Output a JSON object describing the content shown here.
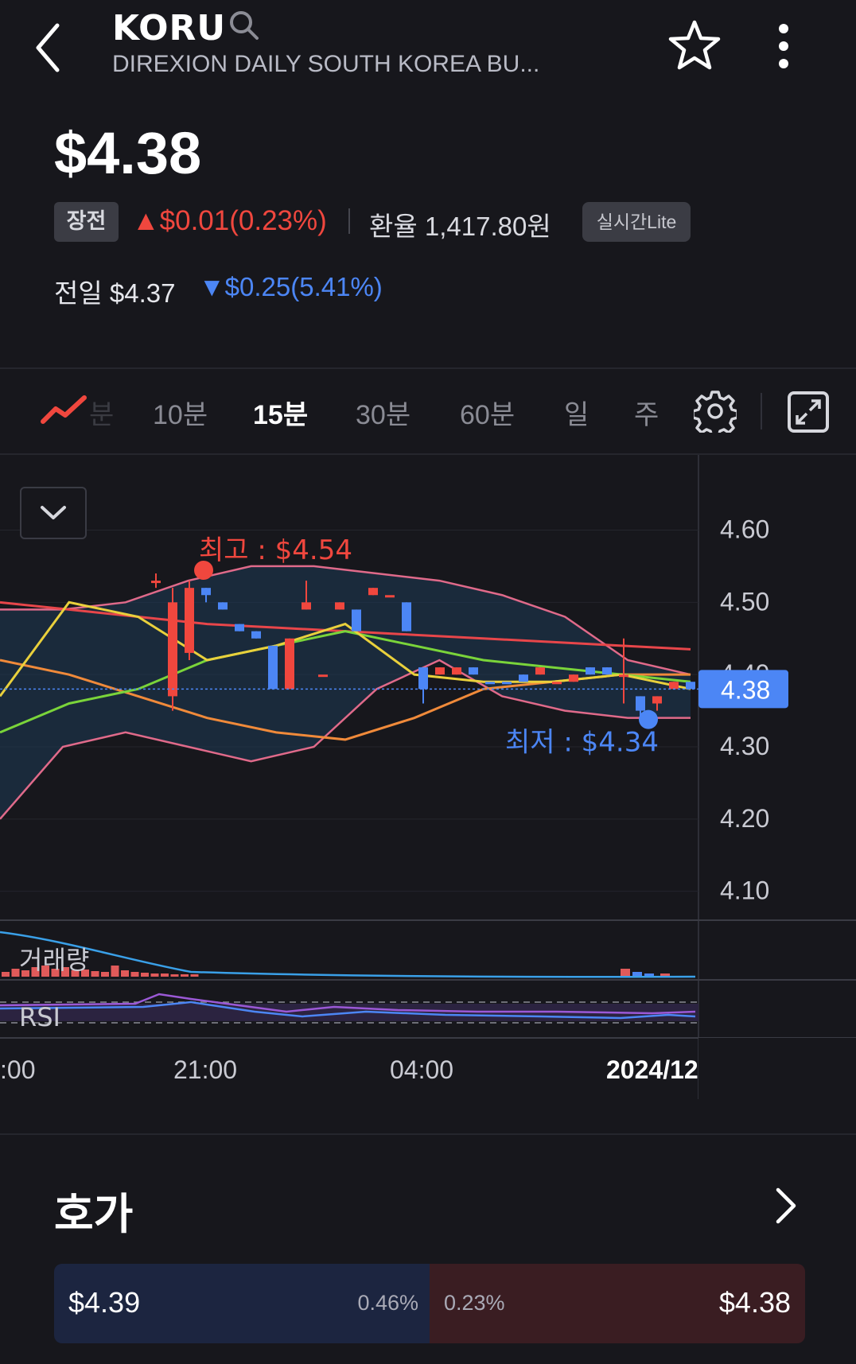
{
  "header": {
    "ticker": "KORU",
    "fullname": "DIREXION DAILY SOUTH KOREA BU...",
    "icons": [
      "back-arrow-icon",
      "search-icon",
      "star-icon",
      "more-vertical-icon"
    ]
  },
  "quote": {
    "price": "$4.38",
    "session": "장전",
    "change": "▲$0.01(0.23%)",
    "fx": "환율 1,417.80원",
    "realtime": "실시간Lite",
    "prev_label": "전일 $4.37",
    "prev_change": "▼$0.25(5.41%)",
    "colors": {
      "up": "#f0473e",
      "down": "#4c86f5"
    }
  },
  "tabs": {
    "faded_partial": "분",
    "items": [
      {
        "label": "10분",
        "active": false
      },
      {
        "label": "15분",
        "active": true
      },
      {
        "label": "30분",
        "active": false
      },
      {
        "label": "60분",
        "active": false
      },
      {
        "label": "일",
        "active": false
      },
      {
        "label": "주",
        "active": false
      }
    ],
    "icons": [
      "line-chart-icon",
      "gear-icon",
      "expand-icon",
      "chevron-down-icon"
    ]
  },
  "chart_data": {
    "type": "candlestick",
    "interval": "15분",
    "y_ticks": [
      "4.60",
      "4.50",
      "4.40",
      "4.30",
      "4.20",
      "4.10"
    ],
    "y_range": [
      4.06,
      4.66
    ],
    "current_price_label": "4.38",
    "current_price": 4.38,
    "high_label": "최고 : $4.54",
    "high": 4.54,
    "low_label": "최저 : $4.34",
    "low": 4.34,
    "x_labels": [
      ":00",
      "21:00",
      "04:00",
      "2024/12"
    ],
    "volume_label": "거래량",
    "rsi_label": "RSI",
    "candles": [
      {
        "o": 4.53,
        "c": 4.53,
        "h": 4.54,
        "l": 4.52,
        "dir": "up"
      },
      {
        "o": 4.37,
        "c": 4.5,
        "h": 4.52,
        "l": 4.35,
        "dir": "up"
      },
      {
        "o": 4.43,
        "c": 4.52,
        "h": 4.53,
        "l": 4.42,
        "dir": "up"
      },
      {
        "o": 4.52,
        "c": 4.51,
        "h": 4.52,
        "l": 4.5,
        "dir": "down"
      },
      {
        "o": 4.5,
        "c": 4.49,
        "h": 4.5,
        "l": 4.49,
        "dir": "down"
      },
      {
        "o": 4.47,
        "c": 4.46,
        "h": 4.47,
        "l": 4.46,
        "dir": "down"
      },
      {
        "o": 4.46,
        "c": 4.45,
        "h": 4.46,
        "l": 4.45,
        "dir": "down"
      },
      {
        "o": 4.44,
        "c": 4.38,
        "h": 4.44,
        "l": 4.38,
        "dir": "down"
      },
      {
        "o": 4.38,
        "c": 4.45,
        "h": 4.45,
        "l": 4.38,
        "dir": "up"
      },
      {
        "o": 4.49,
        "c": 4.5,
        "h": 4.53,
        "l": 4.49,
        "dir": "up"
      },
      {
        "o": 4.4,
        "c": 4.4,
        "h": 4.4,
        "l": 4.4,
        "dir": "up"
      },
      {
        "o": 4.49,
        "c": 4.5,
        "h": 4.5,
        "l": 4.49,
        "dir": "up"
      },
      {
        "o": 4.46,
        "c": 4.49,
        "h": 4.49,
        "l": 4.46,
        "dir": "down"
      },
      {
        "o": 4.52,
        "c": 4.51,
        "h": 4.52,
        "l": 4.51,
        "dir": "up"
      },
      {
        "o": 4.51,
        "c": 4.51,
        "h": 4.51,
        "l": 4.51,
        "dir": "up"
      },
      {
        "o": 4.5,
        "c": 4.46,
        "h": 4.5,
        "l": 4.46,
        "dir": "down"
      },
      {
        "o": 4.41,
        "c": 4.38,
        "h": 4.41,
        "l": 4.36,
        "dir": "down"
      },
      {
        "o": 4.4,
        "c": 4.41,
        "h": 4.41,
        "l": 4.4,
        "dir": "up"
      },
      {
        "o": 4.4,
        "c": 4.41,
        "h": 4.41,
        "l": 4.4,
        "dir": "up"
      },
      {
        "o": 4.41,
        "c": 4.4,
        "h": 4.41,
        "l": 4.4,
        "dir": "down"
      },
      {
        "o": 4.39,
        "c": 4.39,
        "h": 4.39,
        "l": 4.39,
        "dir": "down"
      },
      {
        "o": 4.39,
        "c": 4.39,
        "h": 4.39,
        "l": 4.39,
        "dir": "down"
      },
      {
        "o": 4.4,
        "c": 4.39,
        "h": 4.4,
        "l": 4.39,
        "dir": "down"
      },
      {
        "o": 4.4,
        "c": 4.41,
        "h": 4.41,
        "l": 4.4,
        "dir": "up"
      },
      {
        "o": 4.39,
        "c": 4.39,
        "h": 4.39,
        "l": 4.39,
        "dir": "up"
      },
      {
        "o": 4.39,
        "c": 4.4,
        "h": 4.4,
        "l": 4.39,
        "dir": "up"
      },
      {
        "o": 4.41,
        "c": 4.4,
        "h": 4.41,
        "l": 4.4,
        "dir": "down"
      },
      {
        "o": 4.41,
        "c": 4.4,
        "h": 4.41,
        "l": 4.4,
        "dir": "down"
      },
      {
        "o": 4.4,
        "c": 4.4,
        "h": 4.45,
        "l": 4.36,
        "dir": "up"
      },
      {
        "o": 4.37,
        "c": 4.35,
        "h": 4.37,
        "l": 4.34,
        "dir": "down"
      },
      {
        "o": 4.36,
        "c": 4.37,
        "h": 4.37,
        "l": 4.35,
        "dir": "up"
      },
      {
        "o": 4.38,
        "c": 4.39,
        "h": 4.39,
        "l": 4.38,
        "dir": "up"
      },
      {
        "o": 4.39,
        "c": 4.38,
        "h": 4.39,
        "l": 4.38,
        "dir": "down"
      }
    ],
    "series": [
      {
        "color": "#e8464a",
        "values": [
          4.5,
          4.49,
          4.48,
          4.47,
          4.465,
          4.46,
          4.455,
          4.45,
          4.445,
          4.44,
          4.435
        ]
      },
      {
        "color": "#f08a3a",
        "values": [
          4.42,
          4.4,
          4.37,
          4.34,
          4.32,
          4.31,
          4.34,
          4.38,
          4.39,
          4.4,
          4.4
        ]
      },
      {
        "color": "#7ad43a",
        "values": [
          4.32,
          4.36,
          4.38,
          4.42,
          4.44,
          4.46,
          4.44,
          4.42,
          4.41,
          4.4,
          4.39
        ]
      },
      {
        "color": "#e9d03c",
        "values": [
          4.37,
          4.5,
          4.48,
          4.42,
          4.44,
          4.47,
          4.4,
          4.39,
          4.39,
          4.4,
          4.38
        ]
      }
    ],
    "bollinger_upper": [
      4.49,
      4.49,
      4.5,
      4.53,
      4.55,
      4.55,
      4.54,
      4.53,
      4.51,
      4.48,
      4.42,
      4.4
    ],
    "bollinger_lower": [
      4.2,
      4.3,
      4.32,
      4.3,
      4.28,
      4.3,
      4.38,
      4.42,
      4.37,
      4.35,
      4.34,
      4.34
    ]
  },
  "orderbook": {
    "title": "호가",
    "ask_price": "$4.39",
    "ask_pct": "0.46%",
    "bid_pct": "0.23%",
    "bid_price": "$4.38",
    "ask_share": 0.5,
    "colors": {
      "ask_bg": "#1c2540",
      "bid_bg": "#3a1d22"
    }
  }
}
